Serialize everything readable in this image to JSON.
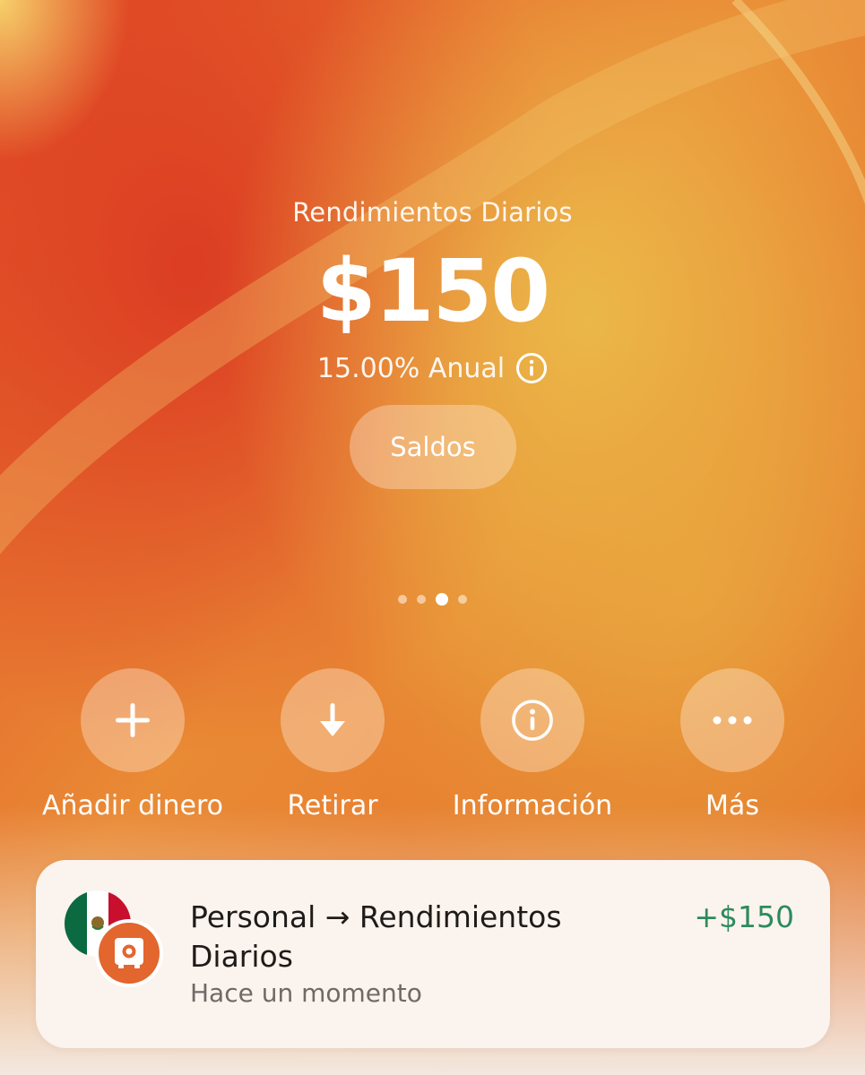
{
  "hero": {
    "title": "Rendimientos Diarios",
    "amount": "$150",
    "rate": "15.00% Anual",
    "rate_info_icon": "info-circle-icon",
    "balances_button": "Saldos"
  },
  "pager": {
    "count": 4,
    "active_index": 3
  },
  "actions": [
    {
      "label": "Añadir dinero",
      "icon": "plus-icon"
    },
    {
      "label": "Retirar",
      "icon": "arrow-down-icon"
    },
    {
      "label": "Información",
      "icon": "info-circle-icon"
    },
    {
      "label": "Más",
      "icon": "more-dots-icon"
    }
  ],
  "transaction": {
    "title": "Personal → Rendimientos Diarios",
    "subtitle": "Hace un momento",
    "amount": "+$150",
    "source_icon": "mexico-flag-icon",
    "target_icon": "vault-icon"
  },
  "colors": {
    "background": "#e5772a",
    "accent_orange": "#e2662e",
    "positive_green": "#2e8a5c",
    "card_background": "#fbf3ee"
  }
}
